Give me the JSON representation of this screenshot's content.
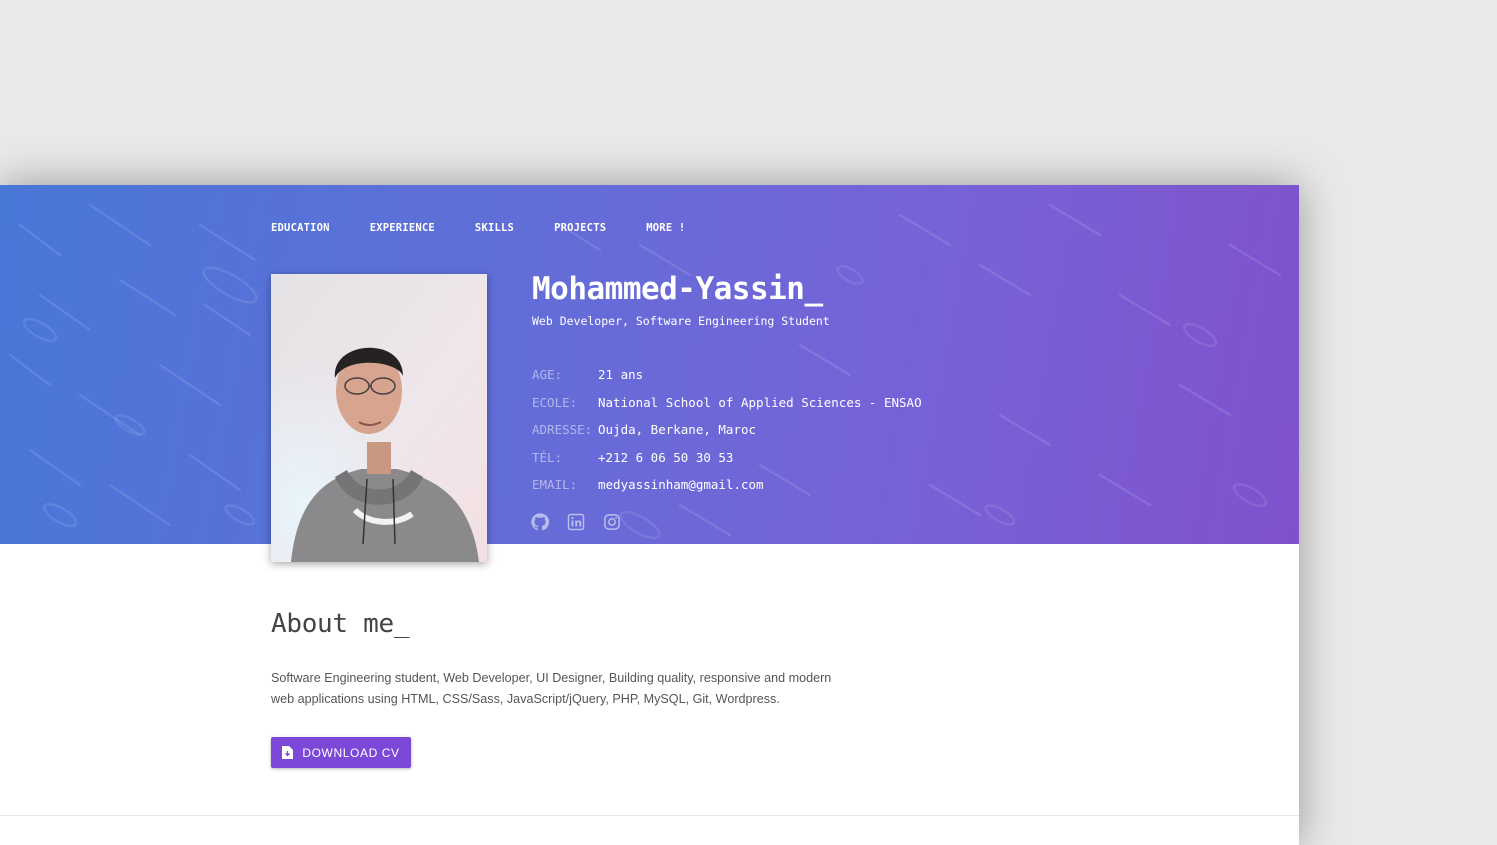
{
  "nav": {
    "items": [
      {
        "label": "EDUCATION"
      },
      {
        "label": "EXPERIENCE"
      },
      {
        "label": "SKILLS"
      },
      {
        "label": "PROJECTS"
      },
      {
        "label": "MORE !"
      }
    ]
  },
  "profile": {
    "name": "Mohammed-Yassin_",
    "subtitle": "Web Developer, Software Engineering Student",
    "info": [
      {
        "label": "AGE:",
        "value": "21 ans"
      },
      {
        "label": "ECOLE:",
        "value": "National School of Applied Sciences - ENSAO"
      },
      {
        "label": "ADRESSE:",
        "value": "Oujda, Berkane, Maroc"
      },
      {
        "label": "TÉL:",
        "value": "+212 6 06 50 30 53"
      },
      {
        "label": "EMAIL:",
        "value": "medyassinham@gmail.com"
      }
    ],
    "socials": [
      "github-icon",
      "linkedin-icon",
      "instagram-icon"
    ]
  },
  "about": {
    "title": "About me_",
    "text": "Software Engineering student, Web Developer, UI Designer, Building quality, responsive and modern web applications using HTML, CSS/Sass, JavaScript/jQuery, PHP, MySQL, Git, Wordpress.",
    "button_label": "DOWNLOAD CV",
    "button_icon": "file-download-icon"
  },
  "colors": {
    "accent": "#7c48d8",
    "hero_start": "#4877d8",
    "hero_end": "#7f52cc"
  }
}
